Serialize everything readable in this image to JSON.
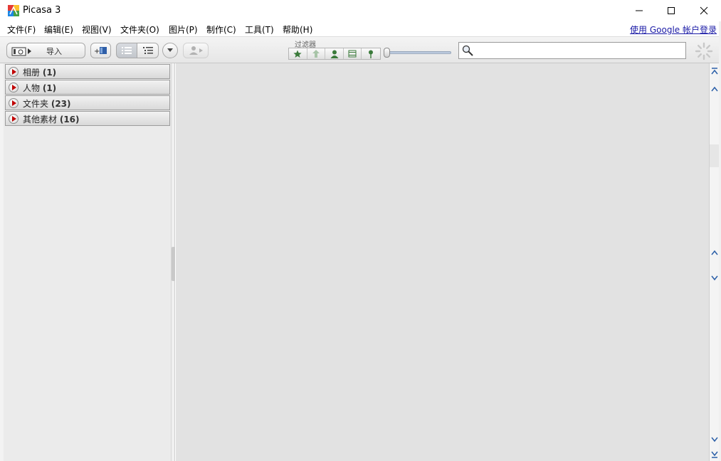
{
  "window": {
    "title": "Picasa 3"
  },
  "menu": {
    "items": [
      {
        "label": "文件(F)"
      },
      {
        "label": "编辑(E)"
      },
      {
        "label": "视图(V)"
      },
      {
        "label": "文件夹(O)"
      },
      {
        "label": "图片(P)"
      },
      {
        "label": "制作(C)"
      },
      {
        "label": "工具(T)"
      },
      {
        "label": "帮助(H)"
      }
    ],
    "login_link": "使用 Google 帐户登录"
  },
  "toolbar": {
    "import_label": "导入",
    "filter_label": "过滤器",
    "filters": [
      "star-icon",
      "upload-icon",
      "person-icon",
      "movie-icon",
      "map-pin-icon"
    ],
    "search": {
      "value": "",
      "placeholder": ""
    }
  },
  "sidebar": {
    "categories": [
      {
        "name": "相册",
        "count": "(1)"
      },
      {
        "name": "人物",
        "count": "(1)"
      },
      {
        "name": "文件夹",
        "count": "(23)"
      },
      {
        "name": "其他素材",
        "count": "(16)"
      }
    ]
  },
  "colors": {
    "accent_arrow": "#c00000",
    "link": "#1a1aa6",
    "main_bg": "#e2e2e2",
    "panel_bg": "#ebebeb"
  }
}
